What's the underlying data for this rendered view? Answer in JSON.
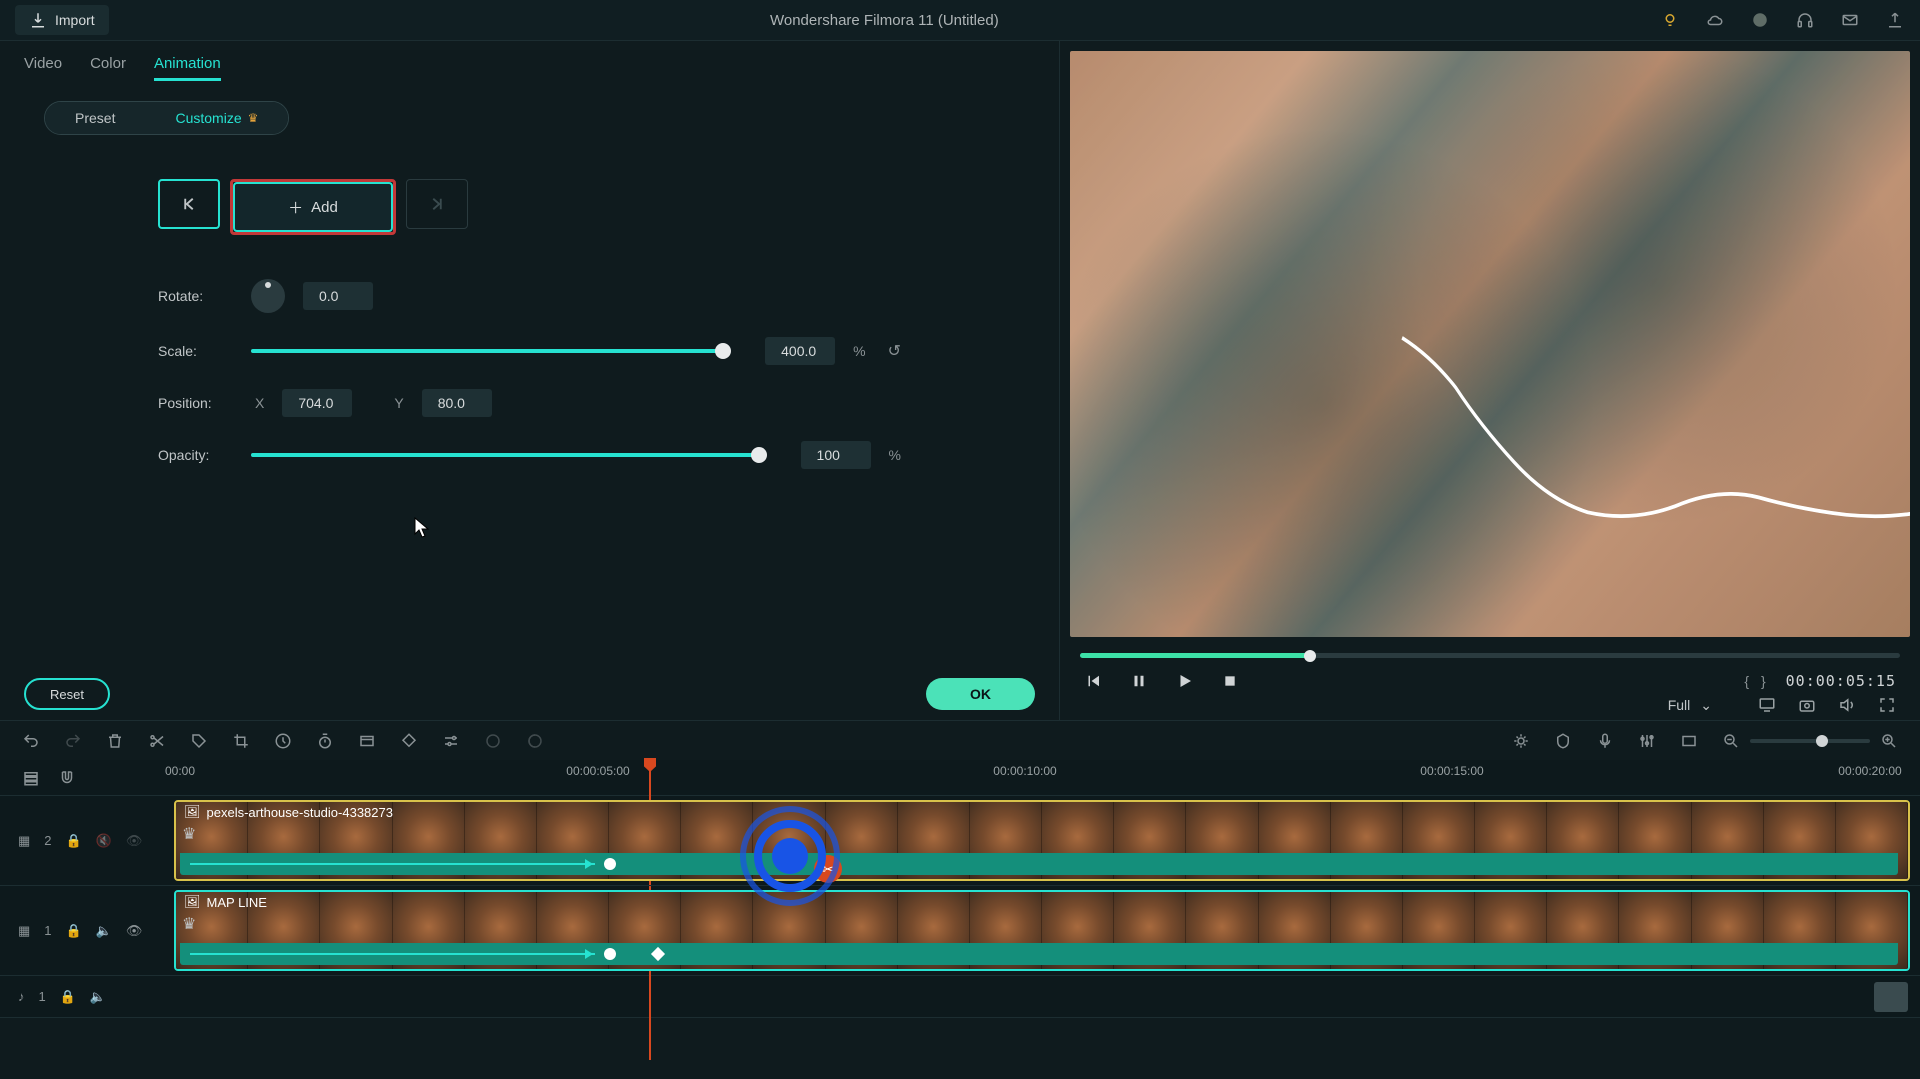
{
  "app_title": "Wondershare Filmora 11 (Untitled)",
  "import_label": "Import",
  "tabs": {
    "video": "Video",
    "color": "Color",
    "animation": "Animation"
  },
  "sub": {
    "preset": "Preset",
    "customize": "Customize"
  },
  "kf": {
    "add": "Add"
  },
  "props": {
    "rotate_label": "Rotate:",
    "rotate_value": "0.0",
    "scale_label": "Scale:",
    "scale_value": "400.0",
    "scale_unit": "%",
    "position_label": "Position:",
    "pos_x_label": "X",
    "pos_x_value": "704.0",
    "pos_y_label": "Y",
    "pos_y_value": "80.0",
    "opacity_label": "Opacity:",
    "opacity_value": "100",
    "opacity_unit": "%"
  },
  "buttons": {
    "reset": "Reset",
    "ok": "OK"
  },
  "player": {
    "timecode": "00:00:05:15",
    "braces": "{    }",
    "display_mode": "Full"
  },
  "ruler": {
    "t0": "00:00",
    "t5": "00:00:05:00",
    "t10": "00:00:10:00",
    "t15": "00:00:15:00",
    "t20": "00:00:20:00"
  },
  "tracks": {
    "v2": "2",
    "v1": "1",
    "a1": "1",
    "clip1_name": "pexels-arthouse-studio-4338273",
    "clip2_name": "MAP LINE"
  }
}
